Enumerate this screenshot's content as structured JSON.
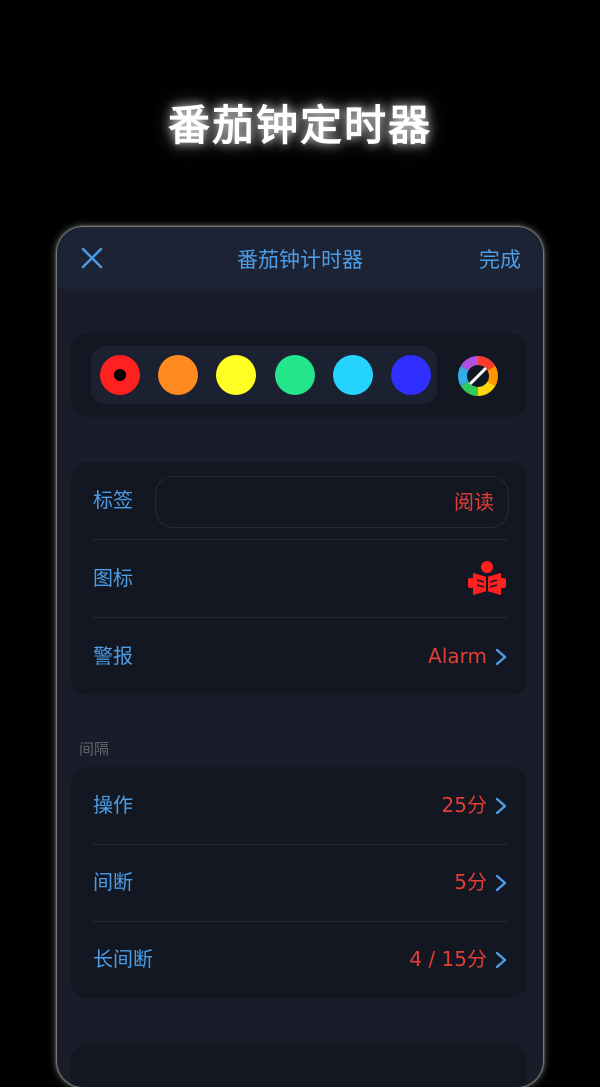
{
  "hero": {
    "title": "番茄钟定时器"
  },
  "navbar": {
    "title": "番茄钟计时器",
    "done_label": "完成",
    "close_icon": "close-icon"
  },
  "colors": {
    "swatches": [
      "#ff2020",
      "#ff8a1f",
      "#ffff24",
      "#23e58a",
      "#24d4ff",
      "#2f2fff"
    ],
    "selected_index": 0,
    "custom_icon": "color-wheel-icon"
  },
  "settings": {
    "label_title": "标签",
    "label_value": "阅读",
    "icon_title": "图标",
    "icon_name": "reading-book-icon",
    "alert_title": "警报",
    "alert_value": "Alarm"
  },
  "interval": {
    "header": "间隔",
    "work_title": "操作",
    "work_value": "25分",
    "break_title": "间断",
    "break_value": "5分",
    "long_break_title": "长间断",
    "long_break_value": "4 / 15分"
  },
  "theme": {
    "accent": "#4c9ce6",
    "value_color": "#e43d36"
  }
}
